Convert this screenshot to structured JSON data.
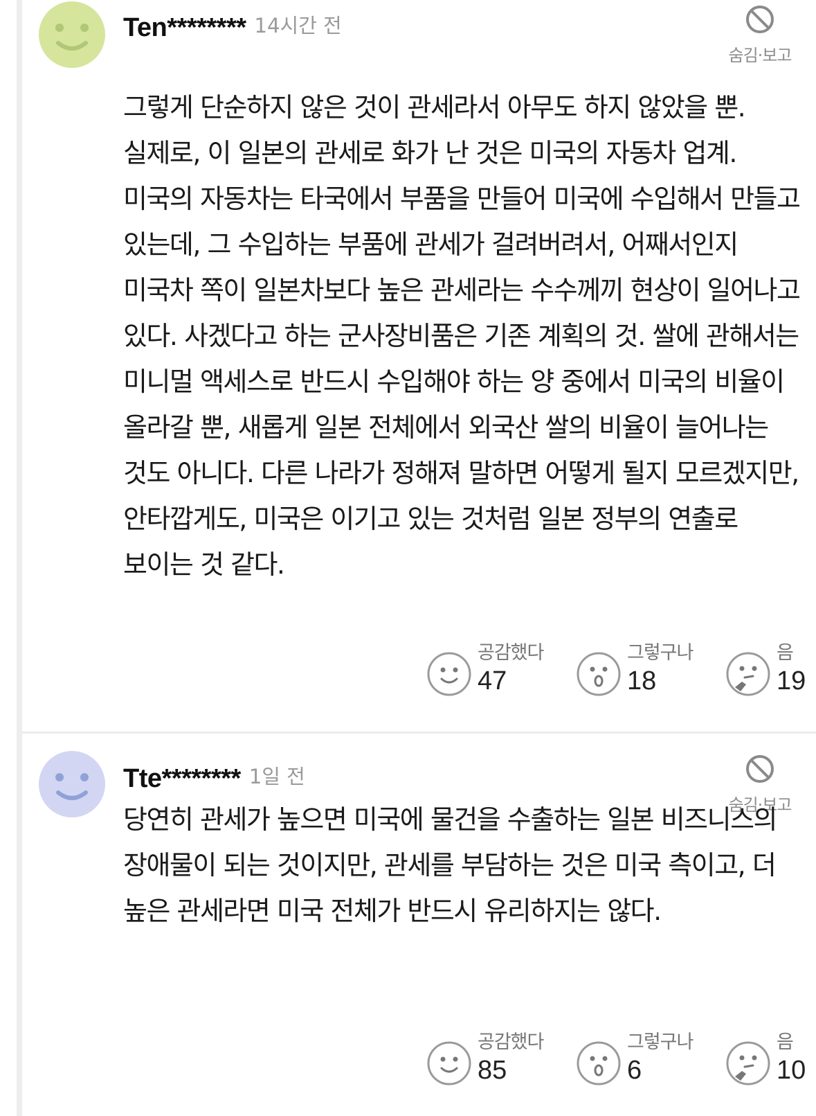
{
  "comments": [
    {
      "nickname": "Ten********",
      "time": "14시간 전",
      "hide_label": "숨김·보고",
      "avatar_color": "#d5e59b",
      "avatar_face_color": "#b0c777",
      "text": "그렇게 단순하지 않은 것이 관세라서 아무도 하지 않았을 뿐. 실제로, 이 일본의 관세로 화가 난 것은 미국의 자동차 업계. 미국의 자동차는 타국에서 부품을 만들어 미국에 수입해서 만들고 있는데, 그 수입하는 부품에 관세가 걸려버려서, 어째서인지 미국차 쪽이 일본차보다 높은 관세라는 수수께끼 현상이 일어나고 있다. 사겠다고 하는 군사장비품은 기존 계획의 것. 쌀에 관해서는 미니멀 액세스로 반드시 수입해야 하는 양 중에서 미국의 비율이 올라갈 뿐, 새롭게 일본 전체에서 외국산 쌀의 비율이 늘어나는 것도 아니다. 다른 나라가 정해져 말하면 어떻게 될지 모르겠지만, 안타깝게도, 미국은 이기고 있는 것처럼 일본 정부의 연출로 보이는 것 같다.",
      "reactions": [
        {
          "label": "공감했다",
          "count": "47",
          "icon": "smile-icon"
        },
        {
          "label": "그렇구나",
          "count": "18",
          "icon": "surprised-icon"
        },
        {
          "label": "음",
          "count": "19",
          "icon": "thinking-icon"
        }
      ]
    },
    {
      "nickname": "Tte********",
      "time": "1일 전",
      "hide_label": "숨김·보고",
      "avatar_color": "#d3d6f2",
      "avatar_face_color": "#8fa2d8",
      "text": "당연히 관세가 높으면 미국에 물건을 수출하는 일본 비즈니스의 장애물이 되는 것이지만, 관세를 부담하는 것은 미국 측이고, 더 높은 관세라면 미국 전체가 반드시 유리하지는 않다.",
      "reactions": [
        {
          "label": "공감했다",
          "count": "85",
          "icon": "smile-icon"
        },
        {
          "label": "그렇구나",
          "count": "6",
          "icon": "surprised-icon"
        },
        {
          "label": "음",
          "count": "10",
          "icon": "thinking-icon"
        }
      ]
    }
  ]
}
